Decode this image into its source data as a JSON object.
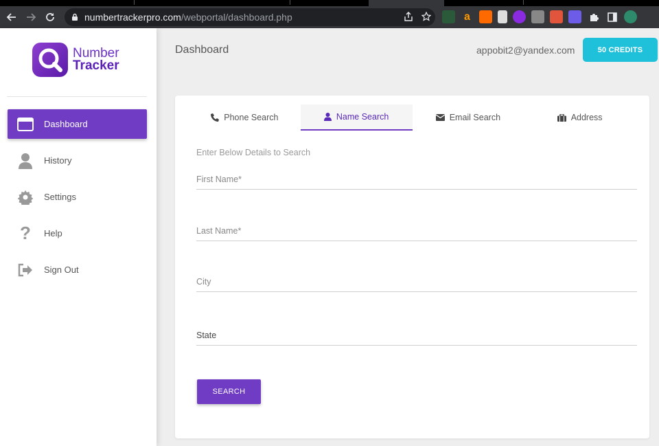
{
  "browser": {
    "url_host": "numbertrackerpro.com",
    "url_path": "/webportal/dashboard.php"
  },
  "logo": {
    "line1": "Number",
    "line2": "Tracker"
  },
  "sidebar": {
    "items": [
      {
        "label": "Dashboard",
        "icon": "dashboard-icon",
        "active": true
      },
      {
        "label": "History",
        "icon": "person-icon"
      },
      {
        "label": "Settings",
        "icon": "gear-icon"
      },
      {
        "label": "Help",
        "icon": "question-icon"
      },
      {
        "label": "Sign Out",
        "icon": "sign-out-icon"
      }
    ]
  },
  "header": {
    "title": "Dashboard",
    "email": "appobit2@yandex.com",
    "credits_label": "50 CREDITS"
  },
  "tabs": [
    {
      "label": "Phone Search",
      "icon": "phone-icon"
    },
    {
      "label": "Name Search",
      "icon": "person-icon",
      "active": true
    },
    {
      "label": "Email Search",
      "icon": "envelope-icon"
    },
    {
      "label": "Address",
      "icon": "briefcase-icon"
    }
  ],
  "form": {
    "hint": "Enter Below Details to Search",
    "first_name_label": "First Name*",
    "last_name_label": "Last Name*",
    "city_label": "City",
    "state_label": "State",
    "submit_label": "SEARCH"
  },
  "colors": {
    "accent": "#6f3cc3",
    "credits": "#1ec1d9"
  }
}
